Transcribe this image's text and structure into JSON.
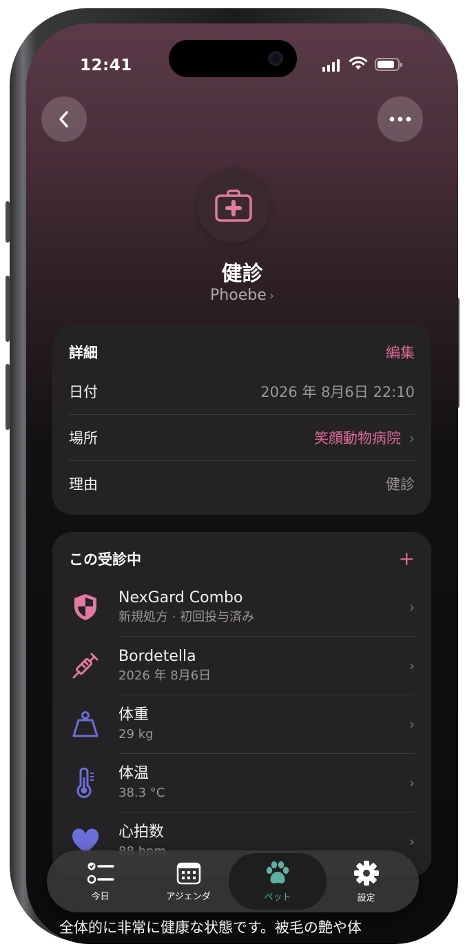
{
  "status_bar": {
    "time": "12:41"
  },
  "header": {
    "title": "健診",
    "pet_name": "Phoebe",
    "icon": "first-aid-kit-icon"
  },
  "details": {
    "title": "詳細",
    "edit_label": "編集",
    "rows": [
      {
        "label": "日付",
        "value": "2026 年 8月6日 22:10"
      },
      {
        "label": "場所",
        "value": "笑顔動物病院"
      },
      {
        "label": "理由",
        "value": "健診"
      }
    ]
  },
  "visit": {
    "title": "この受診中",
    "add_label": "+",
    "items": [
      {
        "title": "NexGard Combo",
        "subtitle": "新規処方 · 初回投与済み",
        "icon": "shield-icon",
        "color": "#e07aa0"
      },
      {
        "title": "Bordetella",
        "subtitle": "2026 年 8月6日",
        "icon": "syringe-icon",
        "color": "#e07aa0"
      },
      {
        "title": "体重",
        "subtitle": "29 kg",
        "icon": "weight-icon",
        "color": "#6c6fd8"
      },
      {
        "title": "体温",
        "subtitle": "38.3 °C",
        "icon": "thermometer-icon",
        "color": "#6c6fd8"
      },
      {
        "title": "心拍数",
        "subtitle": "88 bpm",
        "icon": "heart-icon",
        "color": "#6c6fd8"
      }
    ]
  },
  "notes_preview": "全体的に非常に健康な状態です。被毛の艶や体",
  "tabbar": {
    "tabs": [
      {
        "label": "今日",
        "icon": "checklist-icon"
      },
      {
        "label": "アジェンダ",
        "icon": "calendar-icon"
      },
      {
        "label": "ペット",
        "icon": "paw-icon",
        "active": true
      },
      {
        "label": "設定",
        "icon": "gear-icon"
      }
    ],
    "active_color": "#5fb0a3"
  },
  "colors": {
    "accent": "#d96b95",
    "vital": "#6c6fd8"
  }
}
